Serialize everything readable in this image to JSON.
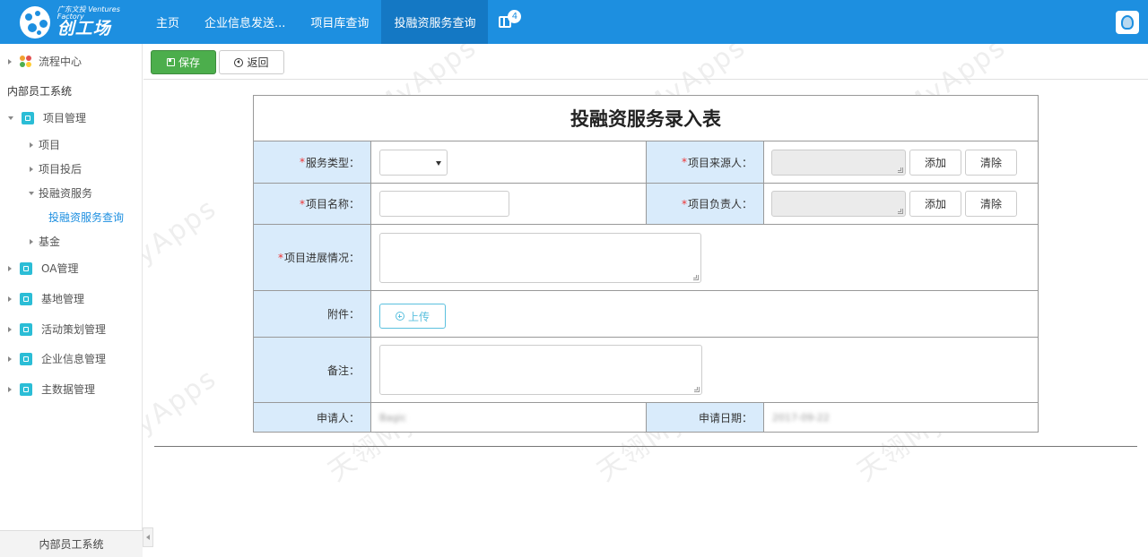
{
  "topbar": {
    "logo_sub": "广东文投 Ventures Factory",
    "logo_main": "创工场",
    "nav": [
      {
        "label": "主页"
      },
      {
        "label": "企业信息发送..."
      },
      {
        "label": "项目库查询"
      },
      {
        "label": "投融资服务查询"
      }
    ],
    "badge_count": "4"
  },
  "sidebar": {
    "flow_center": "流程中心",
    "section_title": "内部员工系统",
    "project_mgmt": "项目管理",
    "project": "项目",
    "post_investment": "项目投后",
    "financing_service": "投融资服务",
    "financing_query": "投融资服务查询",
    "fund": "基金",
    "oa": "OA管理",
    "base": "基地管理",
    "activity": "活动策划管理",
    "enterprise": "企业信息管理",
    "master_data": "主数据管理",
    "footer": "内部员工系统"
  },
  "toolbar": {
    "save_label": "保存",
    "back_label": "返回"
  },
  "form": {
    "title": "投融资服务录入表",
    "service_type_label": "服务类型：",
    "source_person_label": "项目来源人：",
    "project_name_label": "项目名称：",
    "owner_label": "项目负责人：",
    "progress_label": "项目进展情况：",
    "attachment_label": "附件：",
    "remark_label": "备注：",
    "applicant_label": "申请人：",
    "apply_date_label": "申请日期：",
    "add_label": "添加",
    "clear_label": "清除",
    "upload_label": "上传",
    "applicant_value": "Bagic",
    "apply_date_value": "2017-09-22",
    "required_mark": "*"
  },
  "watermark": "天翎MyApps"
}
